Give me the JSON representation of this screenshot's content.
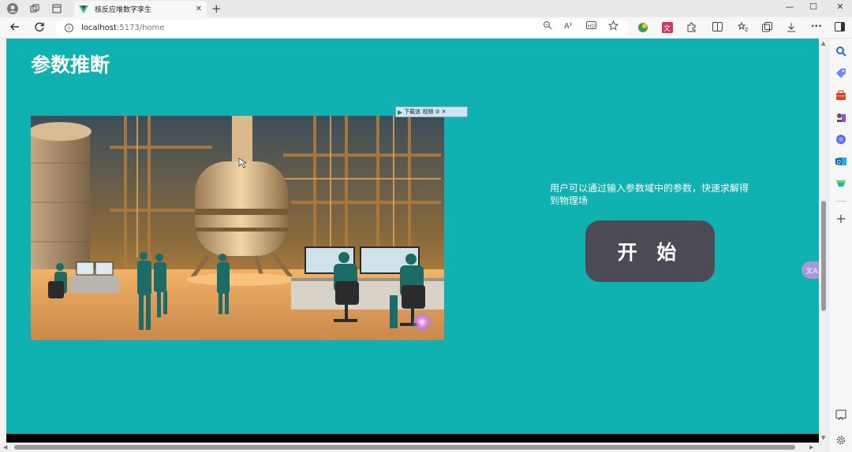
{
  "browser": {
    "tab_title": "核反应堆数字孪生",
    "url_host": "localhost",
    "url_path": ":5173/home",
    "tab_close": "✕",
    "new_tab": "+",
    "more": "···",
    "window_controls": [
      "—",
      "☐",
      "✕"
    ]
  },
  "page": {
    "title": "参数推断",
    "description": "用户可以通过输入参数域中的参数，快速求解得到物理场",
    "start_button": "开 始",
    "download_bar": {
      "label": "下载该 视频",
      "help": "②",
      "close": "✕"
    },
    "translate_bubble": "文A"
  },
  "colors": {
    "page_bg": "#0fb2b0",
    "button_bg": "#4b4a55"
  },
  "sidebar_icons": [
    "search-icon",
    "tag-icon",
    "toolbox-icon",
    "chess-icon",
    "copilot-icon",
    "outlook-icon",
    "drop-icon",
    "add-icon",
    "screenshot-icon",
    "settings-icon"
  ]
}
